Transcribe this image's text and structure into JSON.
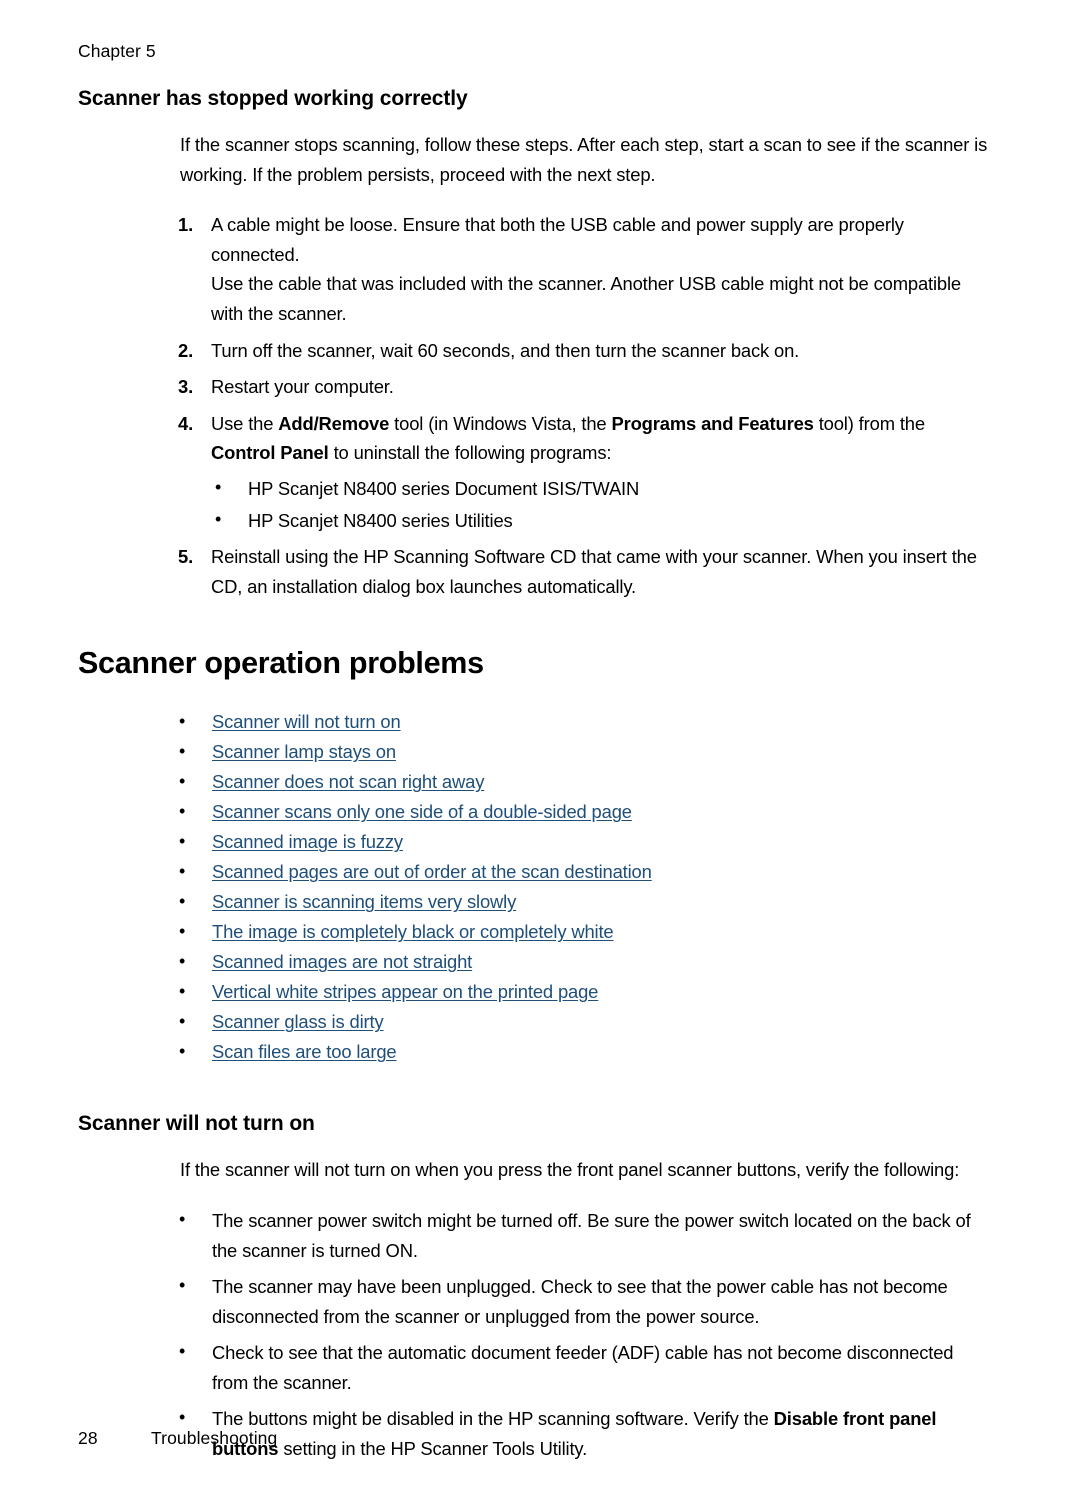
{
  "header": {
    "chapter_label": "Chapter 5"
  },
  "section_stopped_working": {
    "heading": "Scanner has stopped working correctly",
    "intro": "If the scanner stops scanning, follow these steps. After each step, start a scan to see if the scanner is working. If the problem persists, proceed with the next step.",
    "steps": [
      {
        "num": "1.",
        "text": "A cable might be loose. Ensure that both the USB cable and power supply are properly connected.",
        "extra": "Use the cable that was included with the scanner. Another USB cable might not be compatible with the scanner."
      },
      {
        "num": "2.",
        "text": "Turn off the scanner, wait 60 seconds, and then turn the scanner back on."
      },
      {
        "num": "3.",
        "text": "Restart your computer."
      },
      {
        "num": "4.",
        "text_part1": "Use the ",
        "bold1": "Add/Remove",
        "text_part2": " tool (in Windows Vista, the ",
        "bold2": "Programs and Features",
        "text_part3": " tool) from the ",
        "bold3": "Control Panel",
        "text_part4": " to uninstall the following programs:",
        "sub_bullets": [
          "HP Scanjet N8400 series Document ISIS/TWAIN",
          "HP Scanjet N8400 series Utilities"
        ]
      },
      {
        "num": "5.",
        "text": "Reinstall using the HP Scanning Software CD that came with your scanner. When you insert the CD, an installation dialog box launches automatically."
      }
    ]
  },
  "section_operation_problems": {
    "heading": "Scanner operation problems",
    "link_color": "#1f4e79",
    "links": [
      "Scanner will not turn on",
      "Scanner lamp stays on",
      "Scanner does not scan right away",
      "Scanner scans only one side of a double-sided page",
      "Scanned image is fuzzy",
      "Scanned pages are out of order at the scan destination",
      "Scanner is scanning items very slowly",
      "The image is completely black or completely white",
      "Scanned images are not straight",
      "Vertical white stripes appear on the printed page",
      "Scanner glass is dirty",
      "Scan files are too large"
    ]
  },
  "section_will_not_turn_on": {
    "heading": "Scanner will not turn on",
    "intro": "If the scanner will not turn on when you press the front panel scanner buttons, verify the following:",
    "bullets": [
      {
        "text": "The scanner power switch might be turned off. Be sure the power switch located on the back of the scanner is turned ON."
      },
      {
        "text": "The scanner may have been unplugged. Check to see that the power cable has not become disconnected from the scanner or unplugged from the power source."
      },
      {
        "text": "Check to see that the automatic document feeder (ADF) cable has not become disconnected from the scanner."
      },
      {
        "text_part1": "The buttons might be disabled in the HP scanning software. Verify the ",
        "bold1": "Disable front panel buttons",
        "text_part2": " setting in the HP Scanner Tools Utility."
      }
    ]
  },
  "footer": {
    "page_number": "28",
    "label": "Troubleshooting"
  },
  "bullet_glyph": "•"
}
